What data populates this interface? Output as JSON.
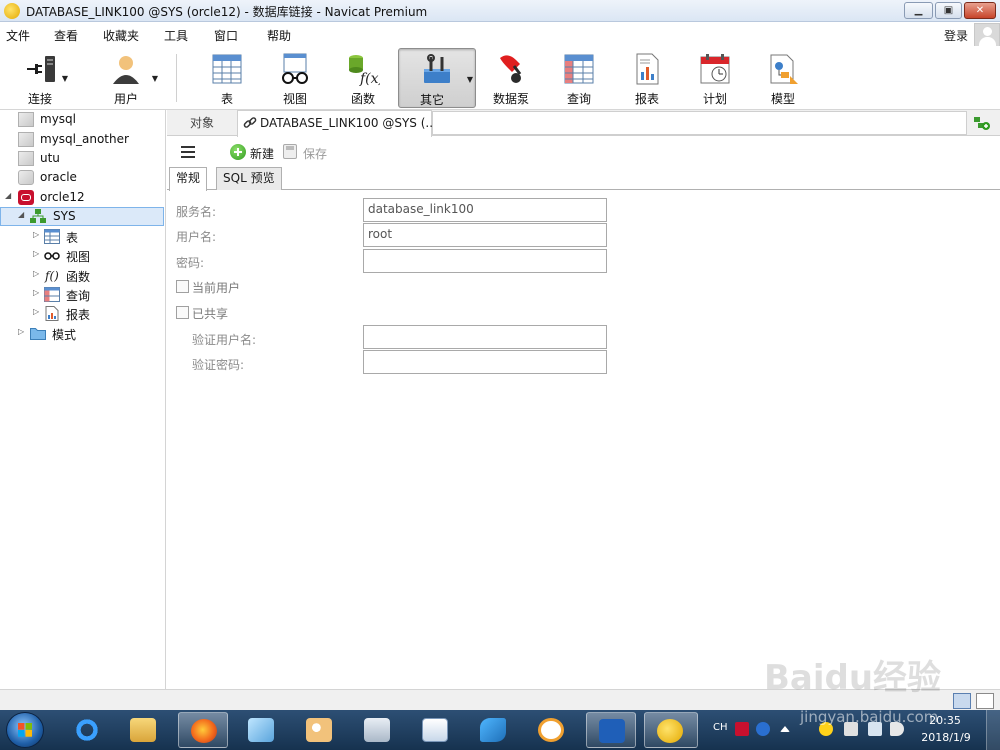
{
  "window": {
    "title": "DATABASE_LINK100 @SYS (orcle12) - 数据库链接 - Navicat Premium",
    "minimize": "▁",
    "maximize": "▣",
    "close": "✕"
  },
  "menu": {
    "items": [
      "文件",
      "查看",
      "收藏夹",
      "工具",
      "窗口",
      "帮助"
    ],
    "login": "登录"
  },
  "toolbar": {
    "buttons": [
      {
        "label": "连接",
        "icon": "plug-icon"
      },
      {
        "label": "用户",
        "icon": "user-icon"
      },
      {
        "label": "表",
        "icon": "table-icon"
      },
      {
        "label": "视图",
        "icon": "view-glasses-icon"
      },
      {
        "label": "函数",
        "icon": "function-icon"
      },
      {
        "label": "其它",
        "icon": "other-tools-icon",
        "active": true
      },
      {
        "label": "数据泵",
        "icon": "data-pump-icon"
      },
      {
        "label": "查询",
        "icon": "query-icon"
      },
      {
        "label": "报表",
        "icon": "report-icon"
      },
      {
        "label": "计划",
        "icon": "schedule-icon"
      },
      {
        "label": "模型",
        "icon": "model-icon"
      }
    ]
  },
  "tree": {
    "connections": [
      "mysql",
      "mysql_another",
      "utu",
      "oracle",
      "orcle12"
    ],
    "schema": "SYS",
    "children": [
      "表",
      "视图",
      "函数",
      "查询",
      "报表"
    ],
    "schemas_node": "模式"
  },
  "tabs": {
    "objects": "对象",
    "document": "DATABASE_LINK100 @SYS (..."
  },
  "editor": {
    "new": "新建",
    "save": "保存",
    "subtabs": [
      "常规",
      "SQL 预览"
    ]
  },
  "form": {
    "service_name_label": "服务名:",
    "service_name_value": "database_link100",
    "username_label": "用户名:",
    "username_value": "root",
    "password_label": "密码:",
    "password_value": "",
    "current_user_label": "当前用户",
    "shared_label": "已共享",
    "auth_user_label": "验证用户名:",
    "auth_user_value": "",
    "auth_password_label": "验证密码:",
    "auth_password_value": ""
  },
  "taskbar": {
    "lang": "CH",
    "time": "20:35",
    "date": "2018/1/9"
  },
  "watermark": {
    "logo_text": "Baidu经验",
    "url": "jingyan.baidu.com"
  }
}
